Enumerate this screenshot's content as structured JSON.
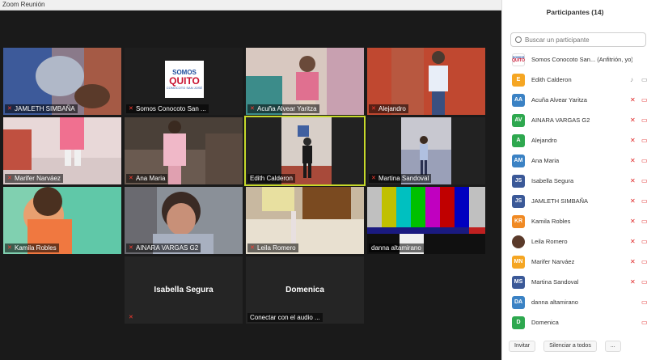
{
  "window": {
    "title": "Zoom Reunión"
  },
  "participants_panel": {
    "title": "Participantes (14)",
    "search_placeholder": "Buscar un participante",
    "participants": [
      {
        "name": "Somos Conocoto San... (Anfitrión, yo)",
        "initials": "",
        "color": "#ffffff",
        "mic": "none",
        "cam": "none"
      },
      {
        "name": "Edith Calderon",
        "initials": "E",
        "color": "#f5a623",
        "mic": "on",
        "cam": "camera-icon"
      },
      {
        "name": "Acuña Alvear Yaritza",
        "initials": "AA",
        "color": "#3b82c4",
        "mic": "muted",
        "cam": "camera-off-icon"
      },
      {
        "name": "AINARA VARGAS   G2",
        "initials": "AV",
        "color": "#2ea84f",
        "mic": "muted",
        "cam": "camera-off-icon"
      },
      {
        "name": "Alejandro",
        "initials": "A",
        "color": "#2ea84f",
        "mic": "muted",
        "cam": "camera-off-icon"
      },
      {
        "name": "Ana Maria",
        "initials": "AM",
        "color": "#3b82c4",
        "mic": "muted",
        "cam": "camera-off-icon"
      },
      {
        "name": "Isabella Segura",
        "initials": "JS",
        "color": "#3b5998",
        "mic": "muted",
        "cam": "camera-off-icon"
      },
      {
        "name": "JAMLETH   SIMBAÑA",
        "initials": "JS",
        "color": "#3b5998",
        "mic": "muted",
        "cam": "camera-off-icon"
      },
      {
        "name": "Kamila Robles",
        "initials": "KR",
        "color": "#f08a24",
        "mic": "muted",
        "cam": "camera-off-icon"
      },
      {
        "name": "Leila Romero",
        "initials": "",
        "color": "#5a3a2a",
        "mic": "muted",
        "cam": "camera-off-icon"
      },
      {
        "name": "Marifer Narváez",
        "initials": "MN",
        "color": "#f5a623",
        "mic": "muted",
        "cam": "camera-off-icon"
      },
      {
        "name": "Martina Sandoval",
        "initials": "MS",
        "color": "#3b5998",
        "mic": "muted",
        "cam": "camera-off-icon"
      },
      {
        "name": "danna altamirano",
        "initials": "DA",
        "color": "#3b82c4",
        "mic": "none",
        "cam": "camera-off-icon"
      },
      {
        "name": "Domenica",
        "initials": "D",
        "color": "#2ea84f",
        "mic": "none",
        "cam": "camera-off-icon"
      }
    ],
    "invite_label": "Invitar",
    "mute_all_label": "Silenciar a todos",
    "more_label": "..."
  },
  "video_tiles": [
    {
      "name": "JAMLETH   SIMBAÑA",
      "muted": true
    },
    {
      "name": "Somos Conocoto San ...",
      "muted": true
    },
    {
      "name": "Acuña Alvear Yaritza",
      "muted": true
    },
    {
      "name": "Alejandro",
      "muted": true
    },
    {
      "name": "Marifer Narváez",
      "muted": true
    },
    {
      "name": "Ana Maria",
      "muted": true
    },
    {
      "name": "Edith Calderon",
      "muted": false
    },
    {
      "name": "Martina Sandoval",
      "muted": true
    },
    {
      "name": "Kamila Robles",
      "muted": true
    },
    {
      "name": "AINARA VARGAS   G2",
      "muted": true
    },
    {
      "name": "Leila Romero",
      "muted": true
    },
    {
      "name": "danna altamirano",
      "muted": false
    },
    {
      "name": "Isabella Segura",
      "muted": true
    },
    {
      "name": "Domenica",
      "muted": false
    }
  ],
  "logo": {
    "line1": "SOMOS",
    "line2": "QUITO",
    "line3": "CONOCOTO SAN JOSÉ"
  },
  "domenica_status": "Conectar con el audio ...",
  "colors": {
    "active_speaker_border": "#c6d92b",
    "muted_mic": "#ff3b30"
  }
}
